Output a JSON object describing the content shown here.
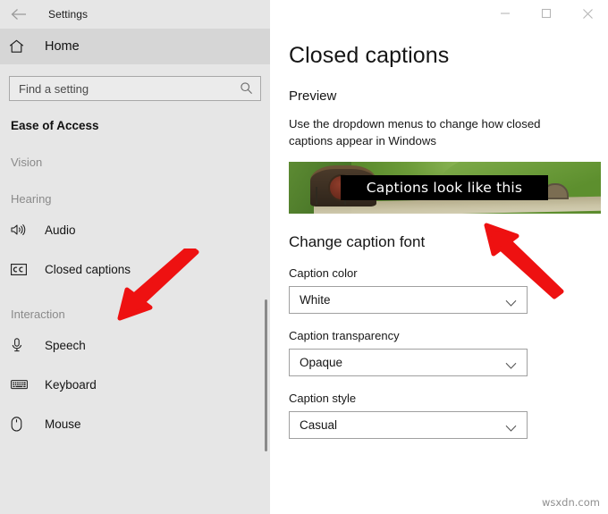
{
  "window": {
    "app_title": "Settings",
    "back_icon": "back-arrow-icon",
    "minimize_label": "─",
    "maximize_label": "☐",
    "close_label": "✕"
  },
  "sidebar": {
    "home": {
      "label": "Home",
      "icon": "home-icon"
    },
    "search": {
      "placeholder": "Find a setting",
      "value": "",
      "icon": "search-icon"
    },
    "section_title": "Ease of Access",
    "groups": [
      {
        "label": "Vision",
        "items": []
      },
      {
        "label": "Hearing",
        "items": [
          {
            "label": "Audio",
            "icon": "speaker-icon",
            "selected": false
          },
          {
            "label": "Closed captions",
            "icon": "closed-caption-icon",
            "selected": true
          }
        ]
      },
      {
        "label": "Interaction",
        "items": [
          {
            "label": "Speech",
            "icon": "microphone-icon",
            "selected": false
          },
          {
            "label": "Keyboard",
            "icon": "keyboard-icon",
            "selected": false
          },
          {
            "label": "Mouse",
            "icon": "mouse-icon",
            "selected": false
          }
        ]
      }
    ]
  },
  "content": {
    "page_title": "Closed captions",
    "preview_heading": "Preview",
    "preview_description": "Use the dropdown menus to change how closed captions appear in Windows",
    "caption_preview_text": "Captions look like this",
    "font_section_heading": "Change caption font",
    "fields": [
      {
        "label": "Caption color",
        "value": "White"
      },
      {
        "label": "Caption transparency",
        "value": "Opaque"
      },
      {
        "label": "Caption style",
        "value": "Casual"
      }
    ]
  },
  "watermark": "wsxdn.com",
  "colors": {
    "sidebar_bg": "#e6e6e6",
    "home_row_bg": "#d6d6d6",
    "content_bg": "#ffffff",
    "text": "#151515",
    "muted_text": "#8a8a8a",
    "annotation_arrow": "#ee1111",
    "caption_bar_bg": "#000000",
    "caption_text": "#ffffff"
  }
}
